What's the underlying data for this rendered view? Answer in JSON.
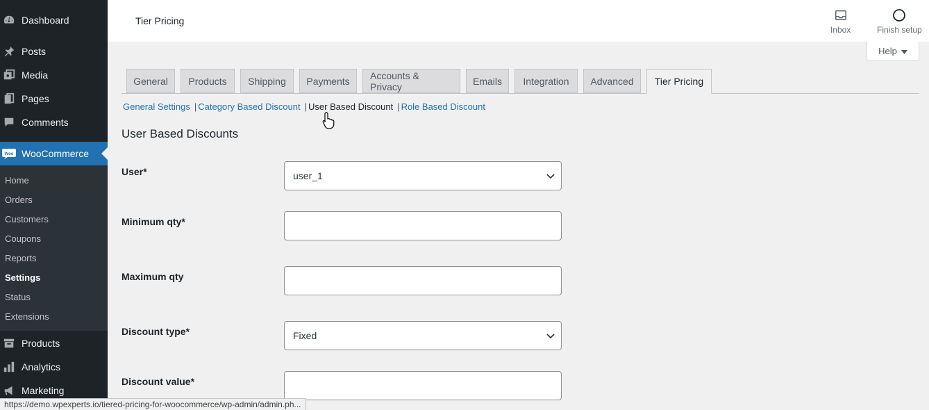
{
  "sidebar": {
    "items": [
      {
        "label": "Dashboard",
        "icon": "dashboard-icon"
      },
      {
        "label": "Posts",
        "icon": "pin-icon"
      },
      {
        "label": "Media",
        "icon": "media-icon"
      },
      {
        "label": "Pages",
        "icon": "pages-icon"
      },
      {
        "label": "Comments",
        "icon": "comment-icon"
      },
      {
        "label": "WooCommerce",
        "icon": "woo-icon"
      },
      {
        "label": "Products",
        "icon": "archive-icon"
      },
      {
        "label": "Analytics",
        "icon": "chart-icon"
      },
      {
        "label": "Marketing",
        "icon": "megaphone-icon"
      }
    ],
    "submenu": [
      "Home",
      "Orders",
      "Customers",
      "Coupons",
      "Reports",
      "Settings",
      "Status",
      "Extensions"
    ],
    "woo_badge": "Woo"
  },
  "topbar": {
    "title": "Tier Pricing",
    "inbox": "Inbox",
    "finish_setup": "Finish setup",
    "help": "Help"
  },
  "tabs": [
    "General",
    "Products",
    "Shipping",
    "Payments",
    "Accounts & Privacy",
    "Emails",
    "Integration",
    "Advanced",
    "Tier Pricing"
  ],
  "subnav": {
    "general": "General Settings",
    "category": "Category Based Discount",
    "user": "User Based Discount",
    "role": "Role Based Discount",
    "sep": "|"
  },
  "form": {
    "title": "User Based Discounts",
    "user_label": "User*",
    "user_value": "user_1",
    "min_label": "Minimum qty*",
    "min_value": "",
    "max_label": "Maximum qty",
    "max_value": "",
    "type_label": "Discount type*",
    "type_value": "Fixed",
    "value_label": "Discount value*",
    "value_value": ""
  },
  "status_url": "https://demo.wpexperts.io/tiered-pricing-for-woocommerce/wp-admin/admin.ph...",
  "colors": {
    "sidebar_bg": "#1d2327",
    "submenu_bg": "#2c3338",
    "accent": "#2271b1",
    "page_bg": "#f0f0f1"
  }
}
